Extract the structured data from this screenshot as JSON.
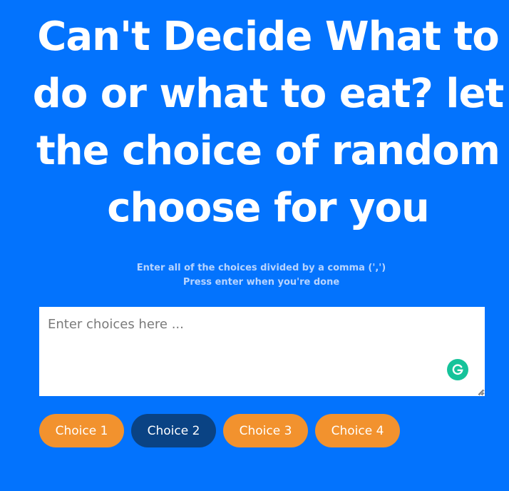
{
  "headline": "Can't Decide What to do or what to eat? let the choice of random choose for you",
  "instructions": {
    "line1": "Enter all of the choices divided by a comma (',')",
    "line2": "Press enter when you're done"
  },
  "input": {
    "placeholder": "Enter choices here ...",
    "value": ""
  },
  "grammarly_icon": "grammarly-g-icon",
  "choices": [
    {
      "label": "Choice 1",
      "selected": false
    },
    {
      "label": "Choice 2",
      "selected": true
    },
    {
      "label": "Choice 3",
      "selected": false
    },
    {
      "label": "Choice 4",
      "selected": false
    }
  ],
  "colors": {
    "background": "#0373fd",
    "choice": "#f2922e",
    "choice_selected": "#0a4384",
    "grammarly": "#15c39a"
  }
}
